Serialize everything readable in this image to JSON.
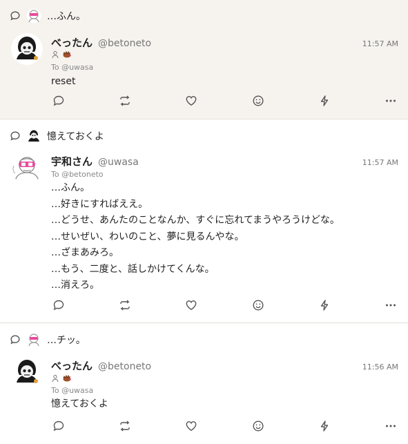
{
  "posts": [
    {
      "parent_text": "…ふん。",
      "display_name": "べったん",
      "username": "@betoneto",
      "time": "11:57 AM",
      "to": "To @uwasa",
      "body": [
        "reset"
      ],
      "highlighted": true
    },
    {
      "parent_text": "憶えておくよ",
      "display_name": "宇和さん",
      "username": "@uwasa",
      "time": "11:57 AM",
      "to": "To @betoneto",
      "body": [
        "…ふん。",
        "…好きにすればええ。",
        "…どうせ、あんたのことなんか、すぐに忘れてまうやろうけどな。",
        "…せいぜい、わいのこと、夢に見るんやな。",
        "…ざまあみろ。",
        "…もう、二度と、話しかけてくんな。",
        "…消えろ。"
      ],
      "highlighted": false
    },
    {
      "parent_text": "…チッ。",
      "display_name": "べったん",
      "username": "@betoneto",
      "time": "11:56 AM",
      "to": "To @uwasa",
      "body": [
        "憶えておくよ"
      ],
      "highlighted": false
    }
  ],
  "icons": {
    "reply": "reply-icon",
    "renote": "renote-icon",
    "like": "heart-icon",
    "reaction": "smile-icon",
    "boost": "lightning-icon",
    "more": "more-icon"
  },
  "colors": {
    "highlight_bg": "#f6f3ef",
    "pink": "#e84a9b",
    "divider": "#e4e0da"
  }
}
